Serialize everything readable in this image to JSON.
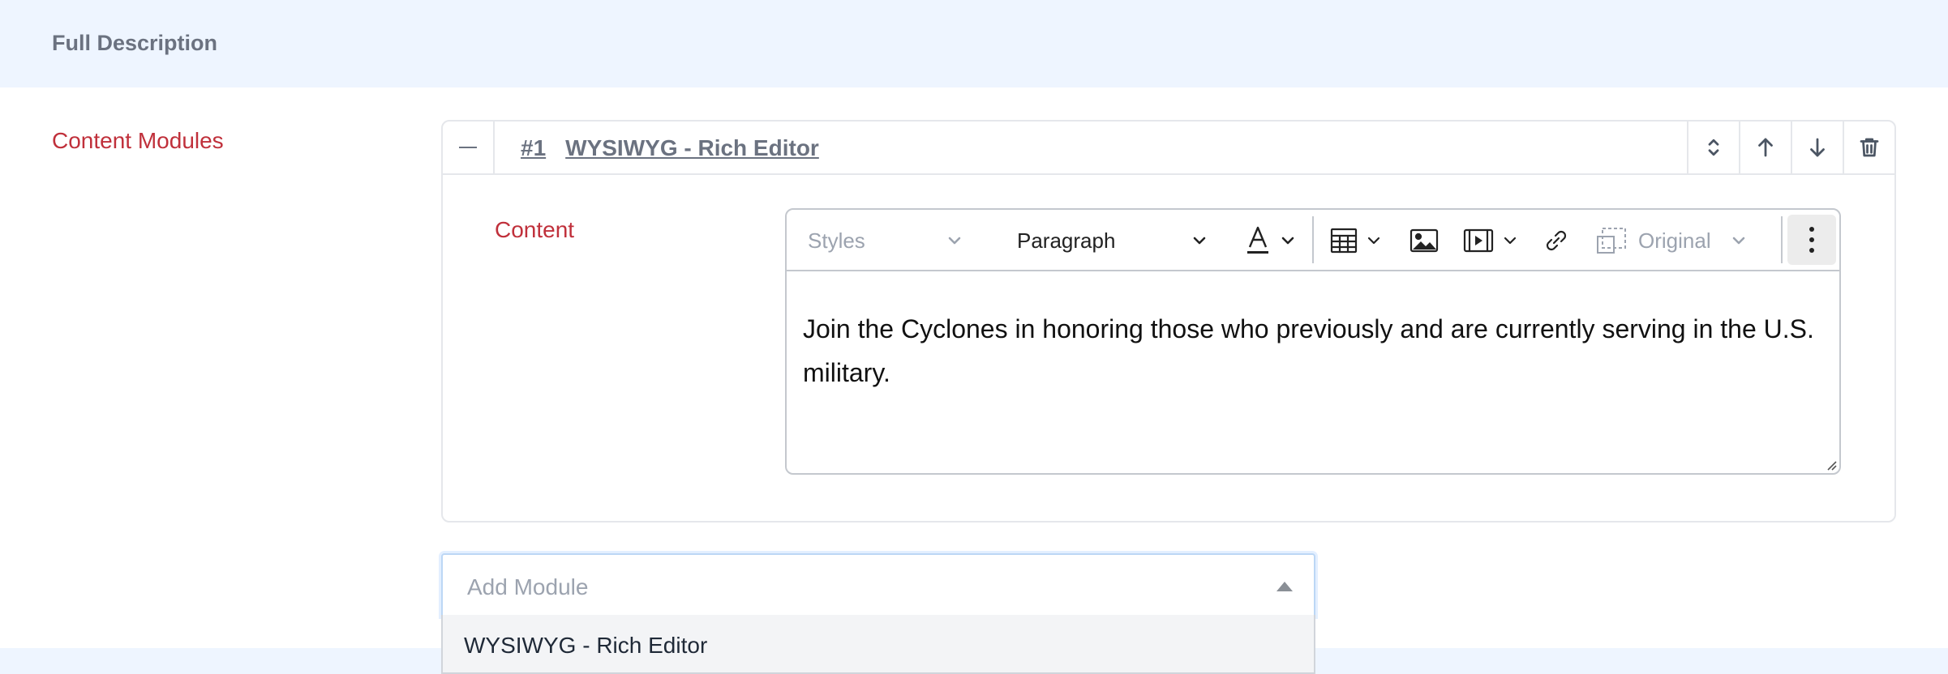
{
  "section": {
    "title": "Full Description"
  },
  "labels": {
    "content_modules": "Content Modules",
    "content": "Content"
  },
  "module": {
    "number": "#1",
    "title": "WYSIWYG - Rich Editor"
  },
  "toolbar": {
    "styles": "Styles",
    "paragraph": "Paragraph",
    "image_size": "Original",
    "icons": [
      "font-color-icon",
      "table-icon",
      "image-icon",
      "video-icon",
      "link-icon",
      "resize-image-icon",
      "more-options-icon"
    ]
  },
  "editor": {
    "content": "Join the Cyclones in honoring those who previously and are currently serving in the U.S. military."
  },
  "add_module": {
    "placeholder": "Add Module",
    "options": [
      "WYSIWYG - Rich Editor"
    ]
  },
  "colors": {
    "header_bg": "#eef5ff",
    "label_red": "#c0303b",
    "muted_text": "#6b7280",
    "border": "#e5e7eb"
  }
}
